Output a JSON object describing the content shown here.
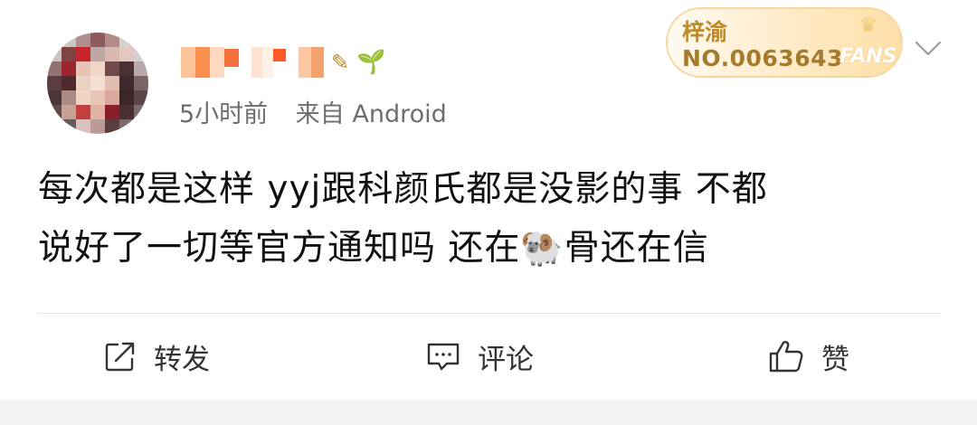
{
  "post": {
    "time_ago": "5小时前",
    "source": "来自 Android",
    "text_line1": "每次都是这样 yyj跟科颜氏都是没影的事 不都",
    "text_line2_a": "说好了一切等官方通知吗 还在",
    "emoji": "🐏",
    "text_line2_b": "骨还在信"
  },
  "user": {
    "avatar_icon": "avatar-pixelated",
    "sprout_icon": "🌱"
  },
  "fan_badge": {
    "name": "梓渝",
    "number": "NO.0063643",
    "fans_label": "FANS",
    "crown_icon": "♛"
  },
  "actions": {
    "repost_label": "转发",
    "comment_label": "评论",
    "like_label": "赞"
  },
  "colors": {
    "text": "#111111",
    "meta": "#6e6e6e",
    "badge_gold": "#c08a2a",
    "divider": "#e6e6e6"
  }
}
